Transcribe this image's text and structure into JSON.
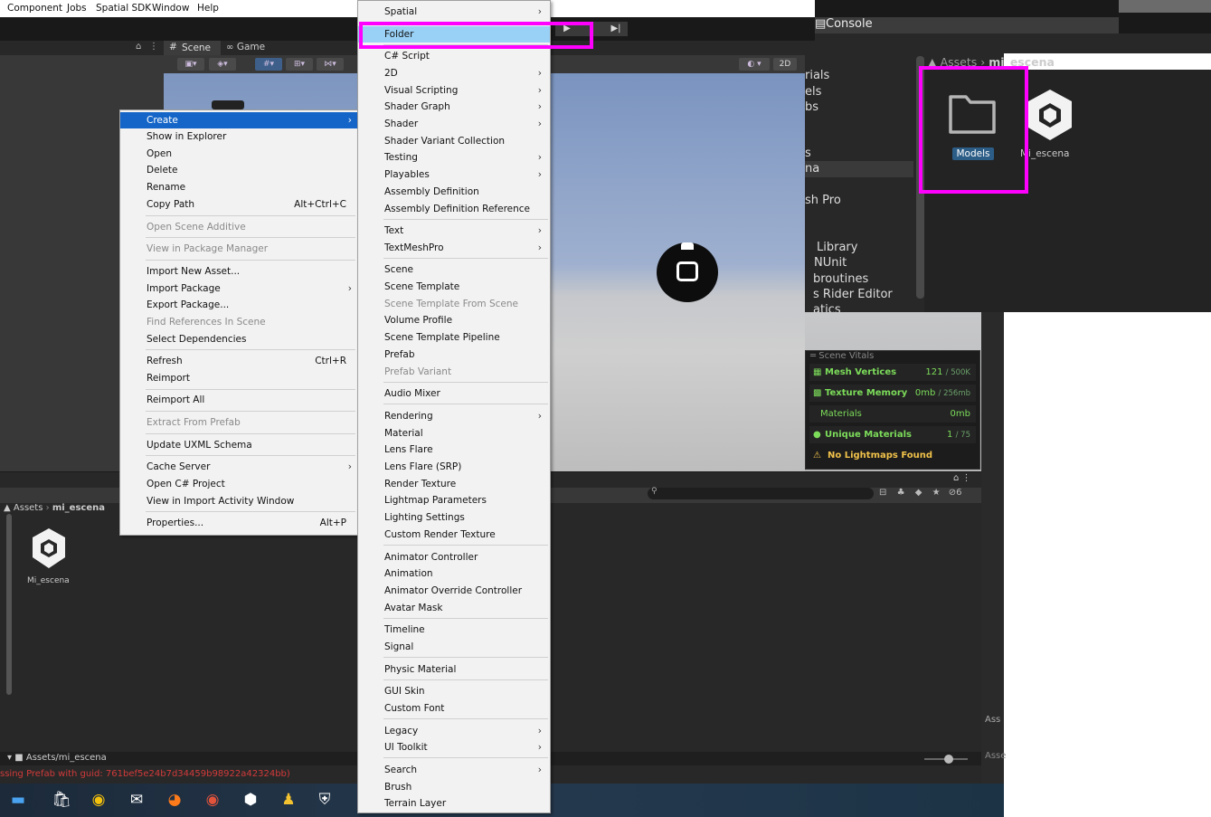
{
  "menubar": {
    "items": [
      "Component",
      "Jobs",
      "Spatial SDK",
      "Window",
      "Help"
    ]
  },
  "scene_tabs": {
    "scene": "Scene",
    "game": "Game",
    "two_d": "2D"
  },
  "context_menu": {
    "items": [
      {
        "label": "Create",
        "arrow": "›",
        "highlighted": true
      },
      {
        "label": "Show in Explorer"
      },
      {
        "label": "Open"
      },
      {
        "label": "Delete"
      },
      {
        "label": "Rename"
      },
      {
        "label": "Copy Path",
        "shortcut": "Alt+Ctrl+C"
      },
      {
        "label": "Open Scene Additive",
        "disabled": true
      },
      {
        "label": "View in Package Manager",
        "disabled": true
      },
      {
        "label": "Import New Asset..."
      },
      {
        "label": "Import Package",
        "arrow": "›"
      },
      {
        "label": "Export Package..."
      },
      {
        "label": "Find References In Scene",
        "disabled": true
      },
      {
        "label": "Select Dependencies"
      },
      {
        "label": "Refresh",
        "shortcut": "Ctrl+R"
      },
      {
        "label": "Reimport"
      },
      {
        "label": "Reimport All"
      },
      {
        "label": "Extract From Prefab",
        "disabled": true
      },
      {
        "label": "Update UXML Schema"
      },
      {
        "label": "Cache Server",
        "arrow": "›"
      },
      {
        "label": "Open C# Project"
      },
      {
        "label": "View in Import Activity Window"
      },
      {
        "label": "Properties...",
        "shortcut": "Alt+P"
      }
    ]
  },
  "create_menu": {
    "items": [
      {
        "label": "Spatial",
        "arrow": "›"
      },
      {
        "label": "Folder",
        "highlighted": true
      },
      {
        "label": "C# Script"
      },
      {
        "label": "2D",
        "arrow": "›"
      },
      {
        "label": "Visual Scripting",
        "arrow": "›"
      },
      {
        "label": "Shader Graph",
        "arrow": "›"
      },
      {
        "label": "Shader",
        "arrow": "›"
      },
      {
        "label": "Shader Variant Collection"
      },
      {
        "label": "Testing",
        "arrow": "›"
      },
      {
        "label": "Playables",
        "arrow": "›"
      },
      {
        "label": "Assembly Definition"
      },
      {
        "label": "Assembly Definition Reference"
      },
      {
        "label": "Text",
        "arrow": "›"
      },
      {
        "label": "TextMeshPro",
        "arrow": "›"
      },
      {
        "label": "Scene"
      },
      {
        "label": "Scene Template"
      },
      {
        "label": "Scene Template From Scene",
        "disabled": true
      },
      {
        "label": "Volume Profile"
      },
      {
        "label": "Scene Template Pipeline"
      },
      {
        "label": "Prefab"
      },
      {
        "label": "Prefab Variant",
        "disabled": true
      },
      {
        "label": "Audio Mixer"
      },
      {
        "label": "Rendering",
        "arrow": "›"
      },
      {
        "label": "Material"
      },
      {
        "label": "Lens Flare"
      },
      {
        "label": "Lens Flare (SRP)"
      },
      {
        "label": "Render Texture"
      },
      {
        "label": "Lightmap Parameters"
      },
      {
        "label": "Lighting Settings"
      },
      {
        "label": "Custom Render Texture"
      },
      {
        "label": "Animator Controller"
      },
      {
        "label": "Animation"
      },
      {
        "label": "Animator Override Controller"
      },
      {
        "label": "Avatar Mask"
      },
      {
        "label": "Timeline"
      },
      {
        "label": "Signal"
      },
      {
        "label": "Physic Material"
      },
      {
        "label": "GUI Skin"
      },
      {
        "label": "Custom Font"
      },
      {
        "label": "Legacy",
        "arrow": "›"
      },
      {
        "label": "UI Toolkit",
        "arrow": "›"
      },
      {
        "label": "Search",
        "arrow": "›"
      },
      {
        "label": "Brush"
      },
      {
        "label": "Terrain Layer"
      }
    ]
  },
  "scene_vitals": {
    "title": "Scene Vitals",
    "rows": [
      {
        "label": "Mesh Vertices",
        "value": "121",
        "limit": "/ 500K"
      },
      {
        "label": "Texture Memory",
        "value": "0mb",
        "limit": "/ 256mb"
      },
      {
        "label": "Materials",
        "value": "0mb",
        "limit": ""
      },
      {
        "label": "Unique Materials",
        "value": "1",
        "limit": "/ 75"
      },
      {
        "label": "No Lightmaps Found",
        "value": "",
        "limit": ""
      }
    ],
    "accent": "#7cdc5a",
    "warning_color": "#f0c24a"
  },
  "project": {
    "breadcrumb_root": "Assets",
    "breadcrumb_leaf": "mi_escena",
    "asset_label": "Mi_escena",
    "footer_path": "Assets/mi_escena",
    "visibility_count": "6",
    "error_text": "ssing Prefab with guid: 761bef5e24b7d34459b98922a42324bb)"
  },
  "console_inset": {
    "tab": "Console",
    "breadcrumb_root": "Assets",
    "breadcrumb_leaf": "mi_escena",
    "folder_label": "Models",
    "scene_label": "Mi_escena",
    "tree_items": [
      "rials",
      "els",
      "bs",
      "s",
      "na",
      "sh Pro",
      "Library",
      "NUnit",
      "broutines",
      "s Rider Editor",
      "atics"
    ],
    "right_labels": [
      "Ass",
      "Asse"
    ]
  },
  "colors": {
    "highlight_box": "#ff00ff",
    "menu_highlight": "#1565c8",
    "submenu_highlight": "#99d0f5",
    "models_badge": "#2c5d87"
  }
}
